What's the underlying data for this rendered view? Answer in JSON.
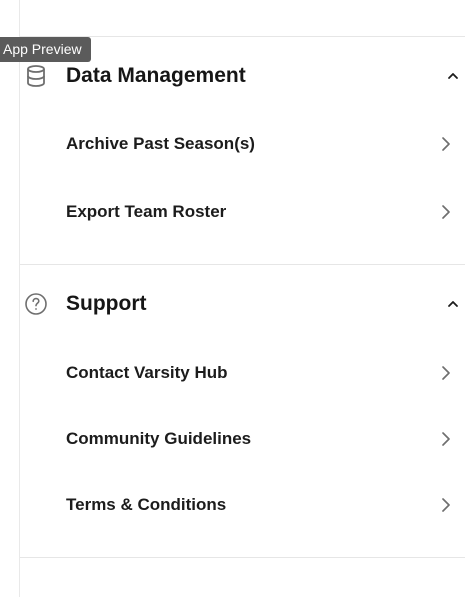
{
  "preview_tag": "App Preview",
  "sections": [
    {
      "title": "Data Management",
      "icon": "database-icon",
      "items": [
        {
          "label": "Archive Past Season(s)"
        },
        {
          "label": "Export Team Roster"
        }
      ]
    },
    {
      "title": "Support",
      "icon": "help-circle-icon",
      "items": [
        {
          "label": "Contact Varsity Hub"
        },
        {
          "label": "Community Guidelines"
        },
        {
          "label": "Terms & Conditions"
        }
      ]
    }
  ],
  "colors": {
    "text": "#161616",
    "divider": "#e6e6e6",
    "icon": "#6f6f6f",
    "preview_tag_bg": "#5b5b5b"
  }
}
